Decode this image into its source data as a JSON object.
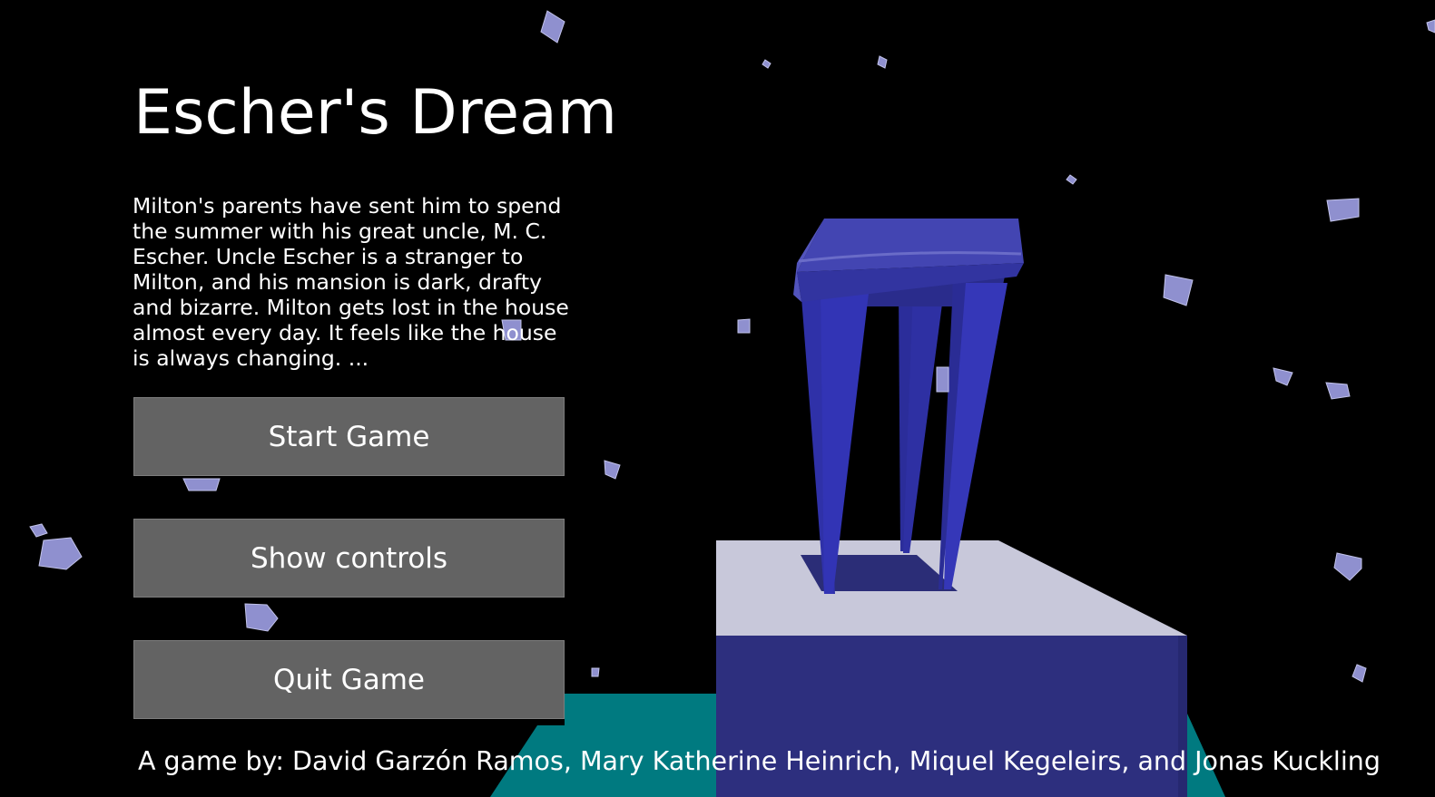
{
  "game": {
    "title": "Escher's Dream",
    "intro": "Milton's parents have sent him to spend the summer with his great uncle, M. C. Escher. Uncle Escher is a stranger to Milton, and his mansion is dark, drafty and bizarre. Milton gets lost in the house almost every day. It feels like the house is always changing. ..."
  },
  "menu": {
    "start_label": "Start Game",
    "controls_label": "Show controls",
    "quit_label": "Quit Game"
  },
  "credits": {
    "text": "A game by: David Garzón Ramos, Mary Katherine Heinrich, Miquel Kegeleirs, and Jonas Kuckling"
  },
  "colors": {
    "background": "#000000",
    "button_fill": "#636363",
    "stool_blue": "#2d2f7e",
    "pedestal_top": "#c7c7d9",
    "floor_teal": "#007a80",
    "debris_lavender": "#8f90cf"
  }
}
